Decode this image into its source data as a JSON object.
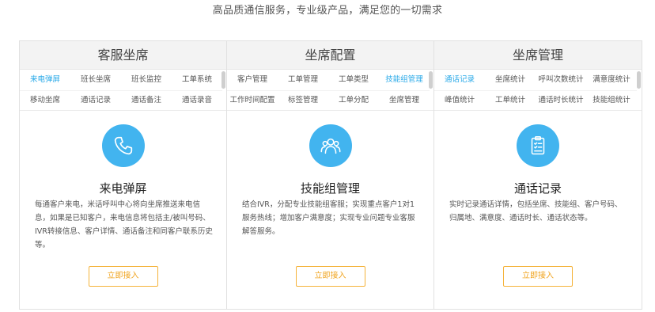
{
  "subtitle": "高品质通信服务，专业级产品，满足您的一切需求",
  "columns": [
    {
      "header": "客服坐席",
      "tabs": [
        "来电弹屏",
        "班长坐席",
        "班长监控",
        "工单系统",
        "移动坐席",
        "通话记录",
        "通话备注",
        "通话录音"
      ],
      "active_tab": 0,
      "icon": "phone-icon",
      "title": "来电弹屏",
      "desc": "每通客户来电，米话呼叫中心将向坐席推送来电信息，如果是已知客户，来电信息将包括主/被叫号码、IVR转接信息、客户详情、通话备注和同客户联系历史等。",
      "button": "立即接入"
    },
    {
      "header": "坐席配置",
      "tabs": [
        "客户管理",
        "工单管理",
        "工单类型",
        "技能组管理",
        "工作时间配置",
        "标签管理",
        "工单分配",
        "坐席管理"
      ],
      "active_tab": 3,
      "icon": "people-icon",
      "title": "技能组管理",
      "desc": "结合IVR，分配专业技能组客服；实现重点客户1对1服务热线；增加客户满意度；实现专业问题专业客服解答服务。",
      "button": "立即接入"
    },
    {
      "header": "坐席管理",
      "tabs": [
        "通话记录",
        "坐席统计",
        "呼叫次数统计",
        "满意度统计",
        "峰值统计",
        "工单统计",
        "通话时长统计",
        "技能组统计"
      ],
      "active_tab": 0,
      "icon": "clipboard-icon",
      "title": "通话记录",
      "desc": "实时记录通话详情，包括坐席、技能组、客户号码、归属地、满意度、通话时长、通话状态等。",
      "button": "立即接入"
    }
  ],
  "colors": {
    "accent_blue": "#42b4ef",
    "active_tab": "#29a9e8",
    "button_orange": "#f0a41f"
  }
}
